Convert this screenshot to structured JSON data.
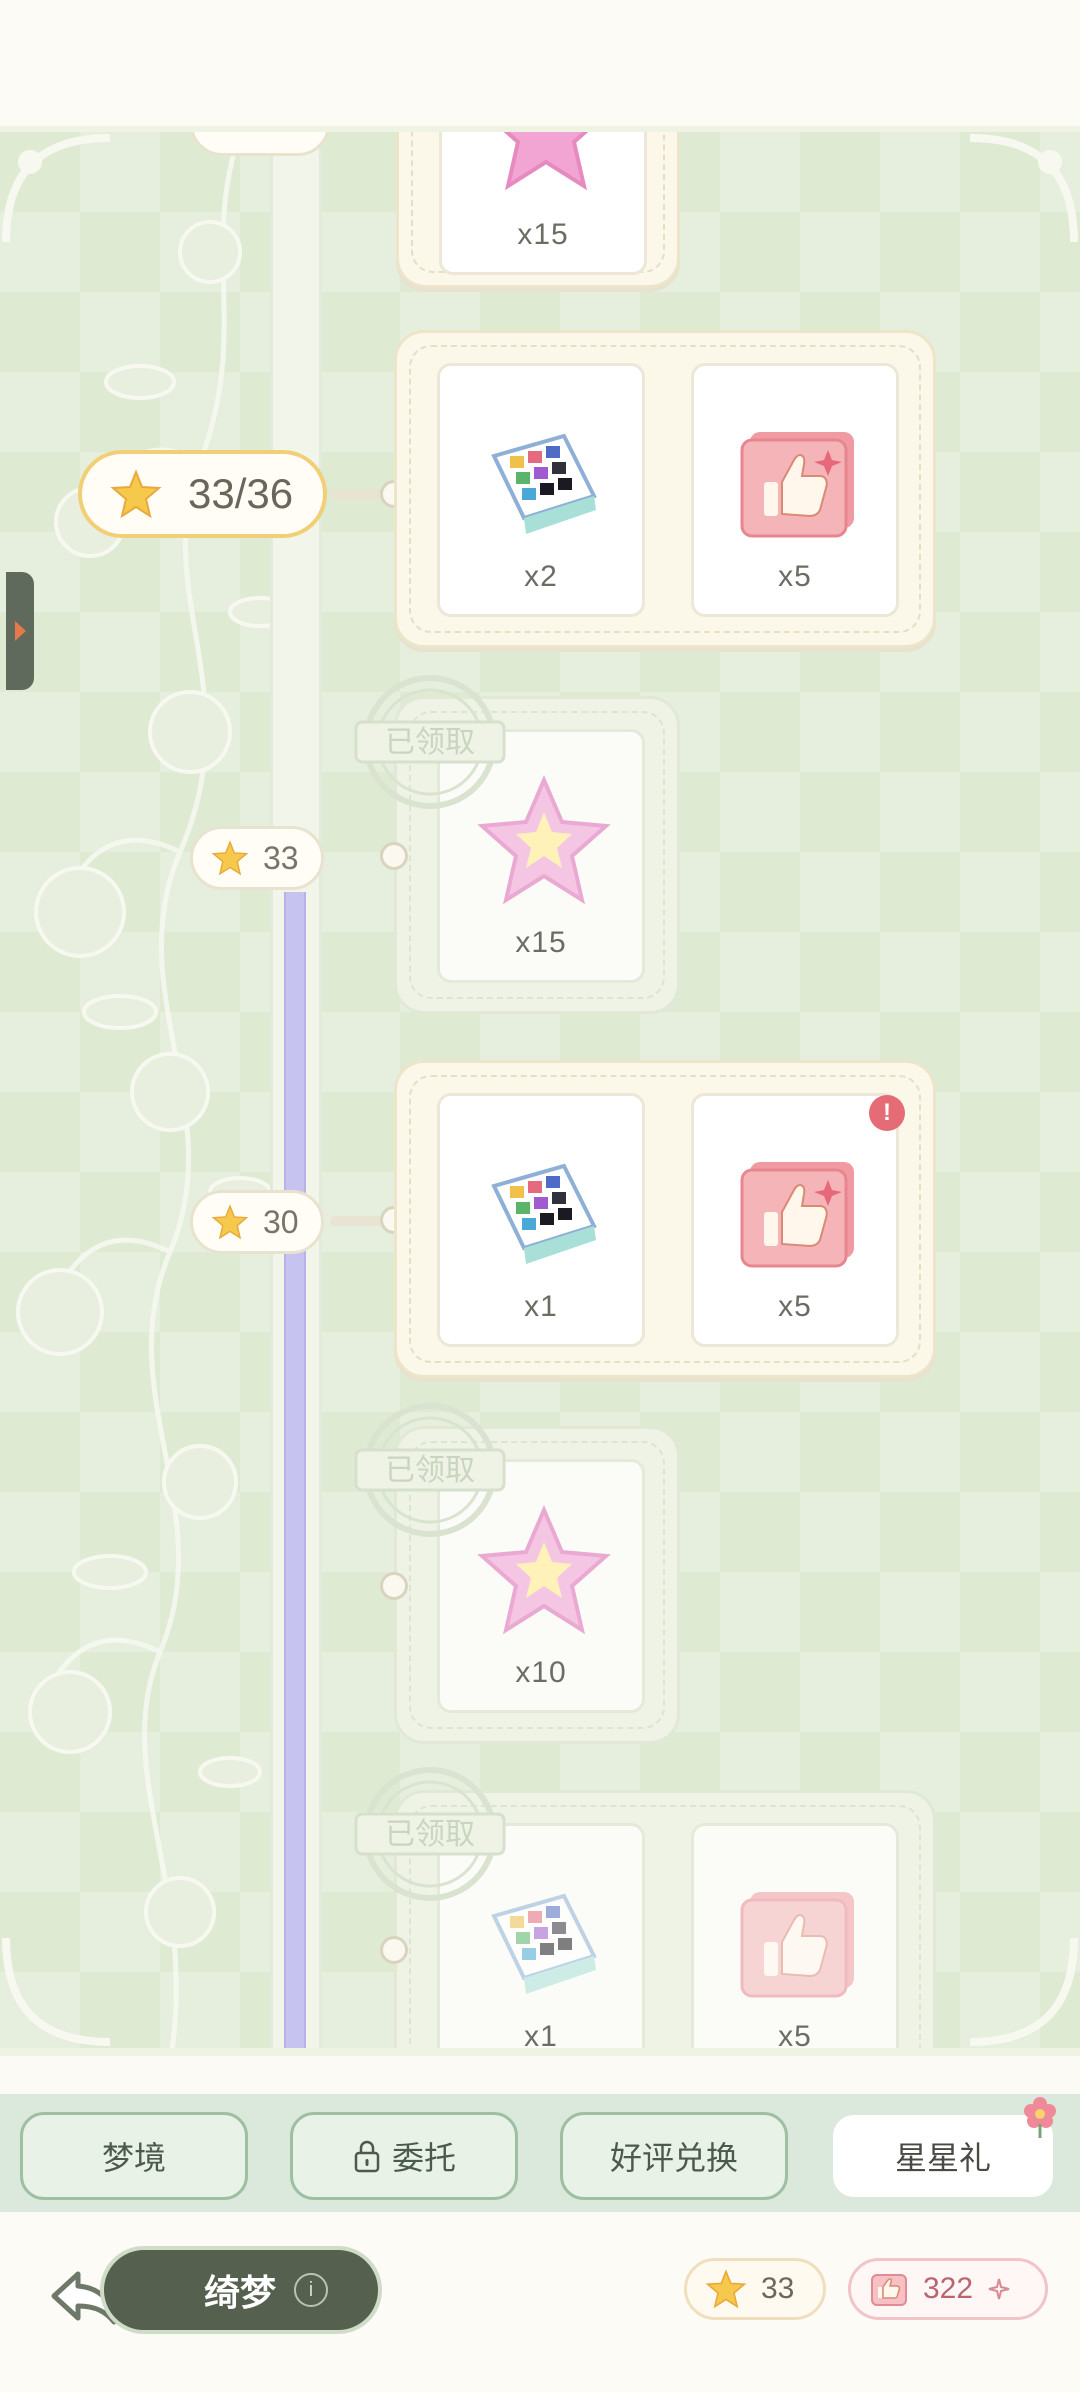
{
  "progress": {
    "current_label": "33/36"
  },
  "milestones": [
    {
      "label": "33"
    },
    {
      "label": "30"
    }
  ],
  "rewards": {
    "top_partial": {
      "qty": "x15"
    },
    "m36": {
      "items": [
        {
          "qty": "x2",
          "icon": "palette-box-icon"
        },
        {
          "qty": "x5",
          "icon": "thumbs-up-card-icon"
        }
      ]
    },
    "m33": {
      "status": "已领取",
      "items": [
        {
          "qty": "x15",
          "icon": "pink-star-icon"
        }
      ]
    },
    "m30": {
      "items": [
        {
          "qty": "x1",
          "icon": "palette-box-icon"
        },
        {
          "qty": "x5",
          "icon": "thumbs-up-card-icon",
          "alert": "!"
        }
      ]
    },
    "m27": {
      "status": "已领取",
      "items": [
        {
          "qty": "x10",
          "icon": "pink-star-icon"
        }
      ]
    },
    "m24": {
      "status": "已领取",
      "items": [
        {
          "qty": "x1",
          "icon": "palette-box-icon"
        },
        {
          "qty": "x5",
          "icon": "thumbs-up-card-icon"
        }
      ]
    }
  },
  "tabs": [
    {
      "label": "梦境"
    },
    {
      "label": "委托",
      "icon": "lock-icon"
    },
    {
      "label": "好评兑换"
    },
    {
      "label": "星星礼",
      "active": true
    }
  ],
  "footer": {
    "chapter_title": "绮梦",
    "info_glyph": "i",
    "star_count": "33",
    "like_count": "322"
  },
  "colors": {
    "accent_gold": "#f1cf77",
    "track_fill": "#c7c3f0",
    "alert": "#e56b77"
  }
}
